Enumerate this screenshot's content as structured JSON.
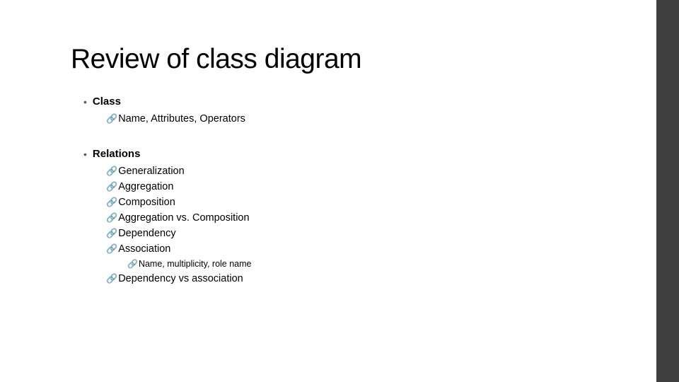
{
  "title": "Review of class diagram",
  "sections": [
    {
      "heading": "Class",
      "items": [
        {
          "text": "Name, Attributes, Operators"
        }
      ]
    },
    {
      "heading": "Relations",
      "items": [
        {
          "text": "Generalization"
        },
        {
          "text": "Aggregation"
        },
        {
          "text": "Composition"
        },
        {
          "text": "Aggregation vs. Composition"
        },
        {
          "text": "Dependency"
        },
        {
          "text": "Association",
          "subitems": [
            {
              "text": "Name, multiplicity, role name"
            }
          ]
        },
        {
          "text": "Dependency vs association"
        }
      ]
    }
  ],
  "icons": {
    "bullet_dot": "•",
    "link_glyph": "🔗"
  }
}
